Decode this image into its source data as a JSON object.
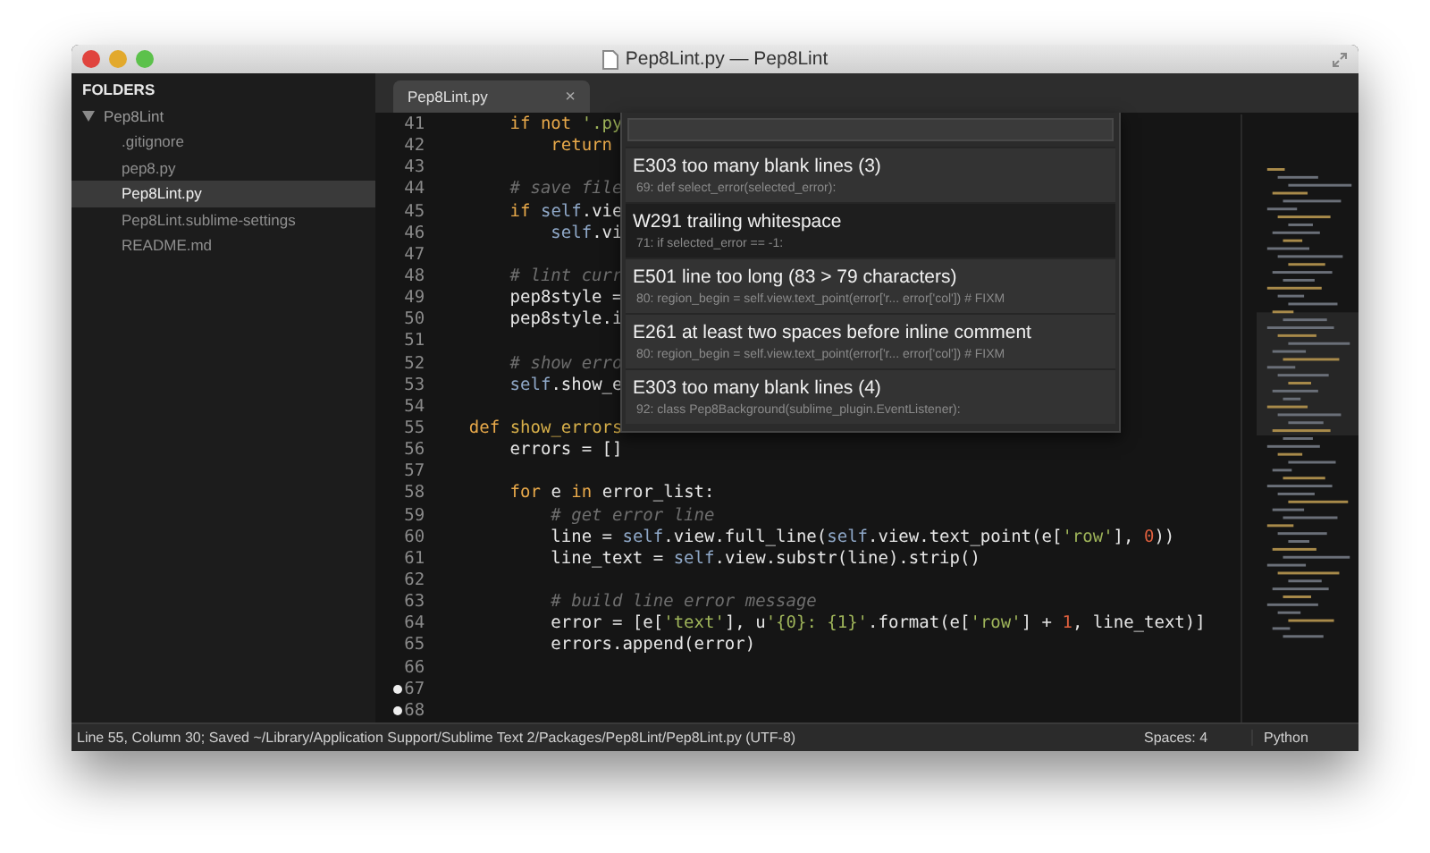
{
  "window": {
    "title": "Pep8Lint.py — Pep8Lint"
  },
  "sidebar": {
    "header": "FOLDERS",
    "folders": [
      {
        "name": "Pep8Lint",
        "expanded": true,
        "children": [
          {
            "name": ".gitignore",
            "selected": false
          },
          {
            "name": "pep8.py",
            "selected": false
          },
          {
            "name": "Pep8Lint.py",
            "selected": true
          },
          {
            "name": "Pep8Lint.sublime-settings",
            "selected": false
          },
          {
            "name": "README.md",
            "selected": false
          }
        ]
      }
    ]
  },
  "tabs": [
    {
      "label": "Pep8Lint.py",
      "selected": true,
      "close": "×"
    }
  ],
  "code": [
    {
      "number": "41",
      "tokens": [
        {
          "kind": "kw",
          "text": "        if not "
        },
        {
          "kind": "str",
          "text": "'.py"
        }
      ]
    },
    {
      "number": "42",
      "tokens": [
        {
          "kind": "kw",
          "text": "            return"
        }
      ]
    },
    {
      "number": "43"
    },
    {
      "number": "44",
      "tokens": [
        {
          "kind": "com",
          "text": "        # save file"
        }
      ]
    },
    {
      "number": "45",
      "tokens": [
        {
          "kind": "kw",
          "text": "        if "
        },
        {
          "kind": "self",
          "text": "self"
        },
        {
          "kind": "plain",
          "text": ".vie"
        }
      ]
    },
    {
      "number": "46",
      "tokens": [
        {
          "kind": "self",
          "text": "            self"
        },
        {
          "kind": "plain",
          "text": ".vi"
        }
      ]
    },
    {
      "number": "47"
    },
    {
      "number": "48",
      "tokens": [
        {
          "kind": "com",
          "text": "        # lint curr"
        }
      ]
    },
    {
      "number": "49",
      "tokens": [
        {
          "kind": "plain",
          "text": "        pep8style ="
        }
      ]
    },
    {
      "number": "50",
      "tokens": [
        {
          "kind": "plain",
          "text": "        pep8style.i"
        }
      ]
    },
    {
      "number": "51"
    },
    {
      "number": "52",
      "tokens": [
        {
          "kind": "com",
          "text": "        # show erro"
        }
      ]
    },
    {
      "number": "53",
      "tokens": [
        {
          "kind": "self",
          "text": "        self"
        },
        {
          "kind": "plain",
          "text": ".show_e"
        }
      ]
    },
    {
      "number": "54"
    },
    {
      "number": "55",
      "tokens": [
        {
          "kind": "kw",
          "text": "    def "
        },
        {
          "kind": "func",
          "text": "show_errors"
        }
      ]
    },
    {
      "number": "56",
      "tokens": [
        {
          "kind": "plain",
          "text": "        errors = []"
        }
      ]
    },
    {
      "number": "57"
    },
    {
      "number": "58",
      "tokens": [
        {
          "kind": "kw",
          "text": "        for"
        },
        {
          "kind": "plain",
          "text": " e "
        },
        {
          "kind": "kw",
          "text": "in"
        },
        {
          "kind": "plain",
          "text": " error_list:"
        }
      ]
    },
    {
      "number": "59",
      "tokens": [
        {
          "kind": "com",
          "text": "            # get error line"
        }
      ]
    },
    {
      "number": "60",
      "tokens": [
        {
          "kind": "plain",
          "text": "            line = "
        },
        {
          "kind": "self",
          "text": "self"
        },
        {
          "kind": "plain",
          "text": ".view.full_line("
        },
        {
          "kind": "self",
          "text": "self"
        },
        {
          "kind": "plain",
          "text": ".view.text_point(e["
        },
        {
          "kind": "str",
          "text": "'row'"
        },
        {
          "kind": "plain",
          "text": "], "
        },
        {
          "kind": "num",
          "text": "0"
        },
        {
          "kind": "plain",
          "text": "))"
        }
      ]
    },
    {
      "number": "61",
      "tokens": [
        {
          "kind": "plain",
          "text": "            line_text = "
        },
        {
          "kind": "self",
          "text": "self"
        },
        {
          "kind": "plain",
          "text": ".view.substr(line).strip()"
        }
      ]
    },
    {
      "number": "62"
    },
    {
      "number": "63",
      "tokens": [
        {
          "kind": "com",
          "text": "            # build line error message"
        }
      ]
    },
    {
      "number": "64",
      "tokens": [
        {
          "kind": "plain",
          "text": "            error = [e["
        },
        {
          "kind": "str",
          "text": "'text'"
        },
        {
          "kind": "plain",
          "text": "], u"
        },
        {
          "kind": "str",
          "text": "'{0}: {1}'"
        },
        {
          "kind": "plain",
          "text": ".format(e["
        },
        {
          "kind": "str",
          "text": "'row'"
        },
        {
          "kind": "plain",
          "text": "] + "
        },
        {
          "kind": "num",
          "text": "1"
        },
        {
          "kind": "plain",
          "text": ", line_text)]"
        }
      ]
    },
    {
      "number": "65",
      "tokens": [
        {
          "kind": "plain",
          "text": "            errors.append(error)"
        }
      ]
    },
    {
      "number": "66"
    },
    {
      "number": "67",
      "modified": true
    },
    {
      "number": "68",
      "modified": true
    }
  ],
  "popup": {
    "items": [
      {
        "title": "E303 too many blank lines (3)",
        "detail": "69: def select_error(selected_error):",
        "selected": false
      },
      {
        "title": "W291 trailing whitespace",
        "detail": "71: if selected_error == -1:",
        "selected": true
      },
      {
        "title": "E501 line too long (83 > 79 characters)",
        "detail": "80: region_begin = self.view.text_point(error['r... error['col']) # FIXM",
        "selected": false
      },
      {
        "title": "E261 at least two spaces before inline comment",
        "detail": "80: region_begin = self.view.text_point(error['r... error['col']) # FIXM",
        "selected": false
      },
      {
        "title": "E303 too many blank lines (4)",
        "detail": "92: class Pep8Background(sublime_plugin.EventListener):",
        "selected": false
      }
    ]
  },
  "status_bar": {
    "message": "Line 55, Column 30; Saved ~/Library/Application Support/Sublime Text 2/Packages/Pep8Lint/Pep8Lint.py (UTF-8)",
    "indentation": "Spaces: 4",
    "syntax": "Python"
  }
}
